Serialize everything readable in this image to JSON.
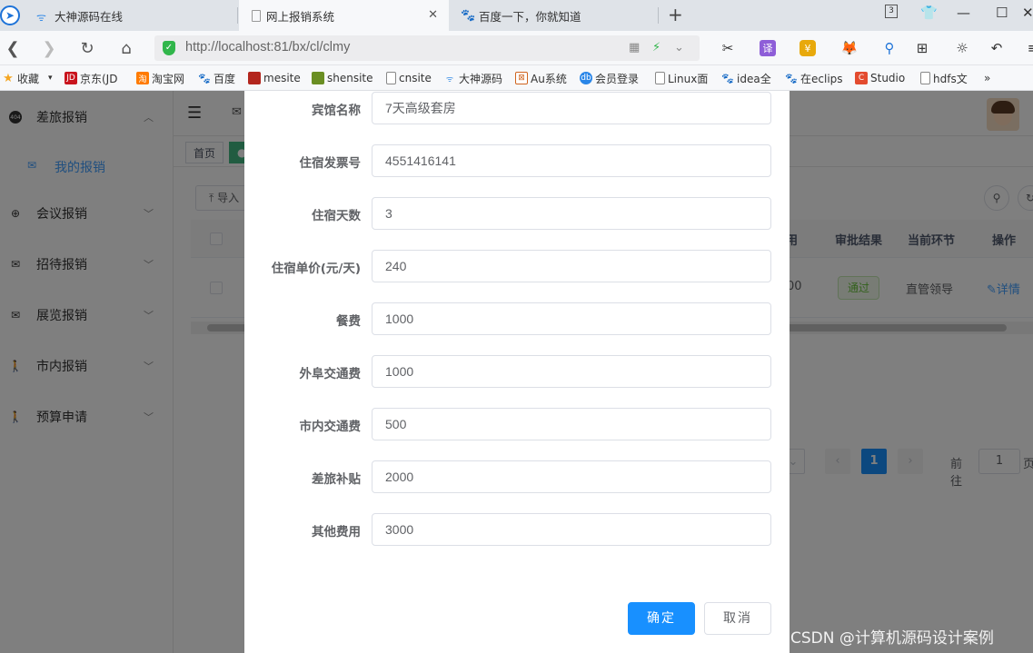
{
  "browser": {
    "tabs": [
      {
        "label": "大神源码在线"
      },
      {
        "label": "网上报销系统"
      },
      {
        "label": "百度一下，你就知道"
      }
    ],
    "tab_counter": "3",
    "url": "http://localhost:81/bx/cl/clmy",
    "bookmarks": [
      {
        "label": "收藏",
        "icon": "star-icon"
      },
      {
        "label": "京东(JD",
        "icon": "jd-icon"
      },
      {
        "label": "淘宝网",
        "icon": "taobao-icon"
      },
      {
        "label": "百度",
        "icon": "baidu-icon"
      },
      {
        "label": "mesite",
        "icon": "mesite-icon"
      },
      {
        "label": "shensite",
        "icon": "shensite-icon"
      },
      {
        "label": "cnsite",
        "icon": "page-icon"
      },
      {
        "label": "大神源码",
        "icon": "swirl-icon"
      },
      {
        "label": "Au系统",
        "icon": "au-icon"
      },
      {
        "label": "会员登录",
        "icon": "member-icon"
      },
      {
        "label": "Linux面",
        "icon": "page-icon"
      },
      {
        "label": "idea全",
        "icon": "baidu-icon"
      },
      {
        "label": "在eclips",
        "icon": "baidu-icon"
      },
      {
        "label": "Studio",
        "icon": "studio-icon"
      },
      {
        "label": "hdfs文",
        "icon": "page-icon"
      }
    ],
    "more_label": "»"
  },
  "sidebar": {
    "items": [
      {
        "label": "差旅报销",
        "icon": "badge-icon"
      },
      {
        "label": "会议报销",
        "icon": "globe-icon"
      },
      {
        "label": "招待报销",
        "icon": "mail-icon"
      },
      {
        "label": "展览报销",
        "icon": "mail-icon"
      },
      {
        "label": "市内报销",
        "icon": "walk-icon"
      },
      {
        "label": "预算申请",
        "icon": "walk-icon"
      }
    ],
    "sub_item": {
      "label": "我的报销",
      "icon": "mail-icon"
    }
  },
  "tags": {
    "home": "首页"
  },
  "toolbar": {
    "import_label": "导入"
  },
  "table": {
    "headers": {
      "fee": "用",
      "result": "审批结果",
      "stage": "当前环节",
      "action": "操作"
    },
    "row": {
      "fee_tail": "00",
      "result": "通过",
      "stage": "直管领导",
      "action": "详情"
    }
  },
  "pager": {
    "current": "1",
    "goto_label": "前往",
    "goto_value": "1",
    "unit": "页"
  },
  "dialog": {
    "fields": [
      {
        "label": "宾馆名称",
        "value": "7天高级套房"
      },
      {
        "label": "住宿发票号",
        "value": "4551416141"
      },
      {
        "label": "住宿天数",
        "value": "3"
      },
      {
        "label": "住宿单价(元/天)",
        "value": "240"
      },
      {
        "label": "餐费",
        "value": "1000"
      },
      {
        "label": "外阜交通费",
        "value": "1000"
      },
      {
        "label": "市内交通费",
        "value": "500"
      },
      {
        "label": "差旅补贴",
        "value": "2000"
      },
      {
        "label": "其他费用",
        "value": "3000"
      }
    ],
    "confirm_label": "确定",
    "cancel_label": "取消"
  },
  "watermark": "CSDN @计算机源码设计案例",
  "colors": {
    "primary": "#1890ff",
    "success": "#67c23a",
    "mask": "rgba(0,0,0,0.5)"
  }
}
